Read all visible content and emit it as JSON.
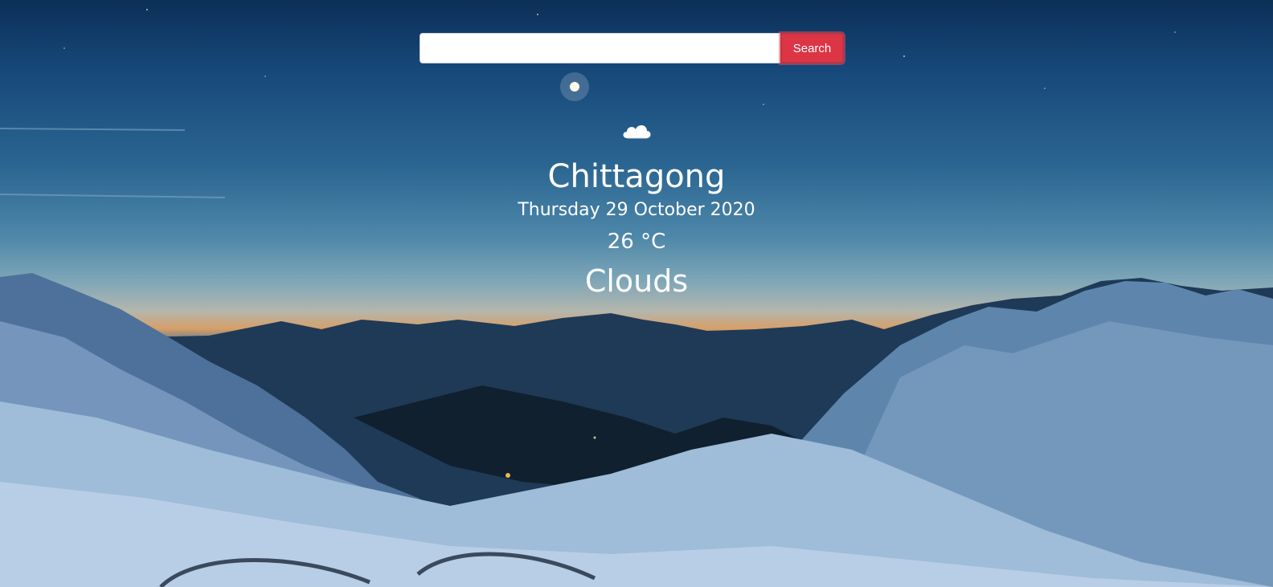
{
  "search": {
    "input_value": "",
    "button_label": "Search"
  },
  "weather": {
    "icon": "cloud-icon",
    "city": "Chittagong",
    "date": "Thursday 29 October 2020",
    "temperature": "26 °C",
    "condition": "Clouds"
  },
  "colors": {
    "accent": "#dc3545",
    "text": "#ffffff"
  }
}
